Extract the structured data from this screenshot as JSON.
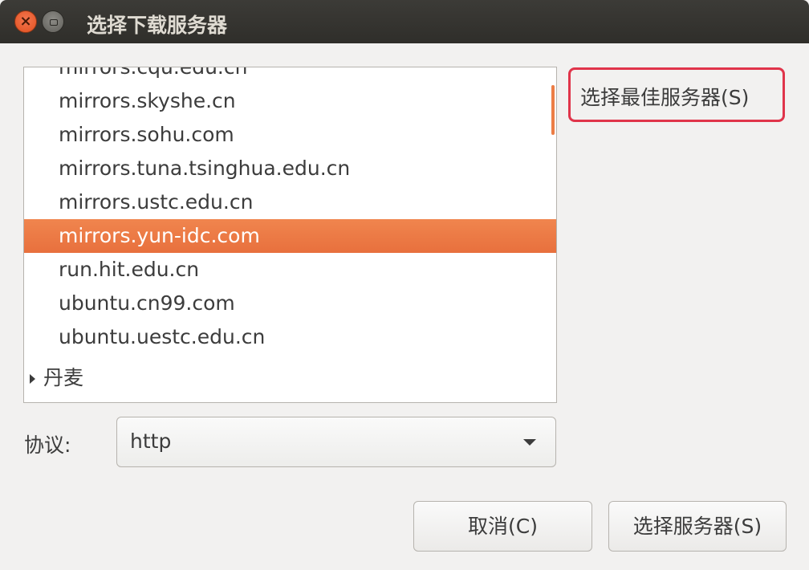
{
  "window": {
    "title": "选择下载服务器",
    "close_glyph": "×"
  },
  "server_list": {
    "items": [
      {
        "label": "mirrors.cqu.edu.cn",
        "selected": false
      },
      {
        "label": "mirrors.skyshe.cn",
        "selected": false
      },
      {
        "label": "mirrors.sohu.com",
        "selected": false
      },
      {
        "label": "mirrors.tuna.tsinghua.edu.cn",
        "selected": false
      },
      {
        "label": "mirrors.ustc.edu.cn",
        "selected": false
      },
      {
        "label": "mirrors.yun-idc.com",
        "selected": true
      },
      {
        "label": "run.hit.edu.cn",
        "selected": false
      },
      {
        "label": "ubuntu.cn99.com",
        "selected": false
      },
      {
        "label": "ubuntu.uestc.edu.cn",
        "selected": false
      }
    ],
    "collapsed_group": "丹麦"
  },
  "best_server_button": "选择最佳服务器(S)",
  "protocol": {
    "label": "协议:",
    "value": "http"
  },
  "buttons": {
    "cancel": "取消(C)",
    "choose": "选择服务器(S)"
  },
  "colors": {
    "selection": "#e8703d",
    "highlight_border": "#e0344a",
    "titlebar": "#3c3b37"
  }
}
